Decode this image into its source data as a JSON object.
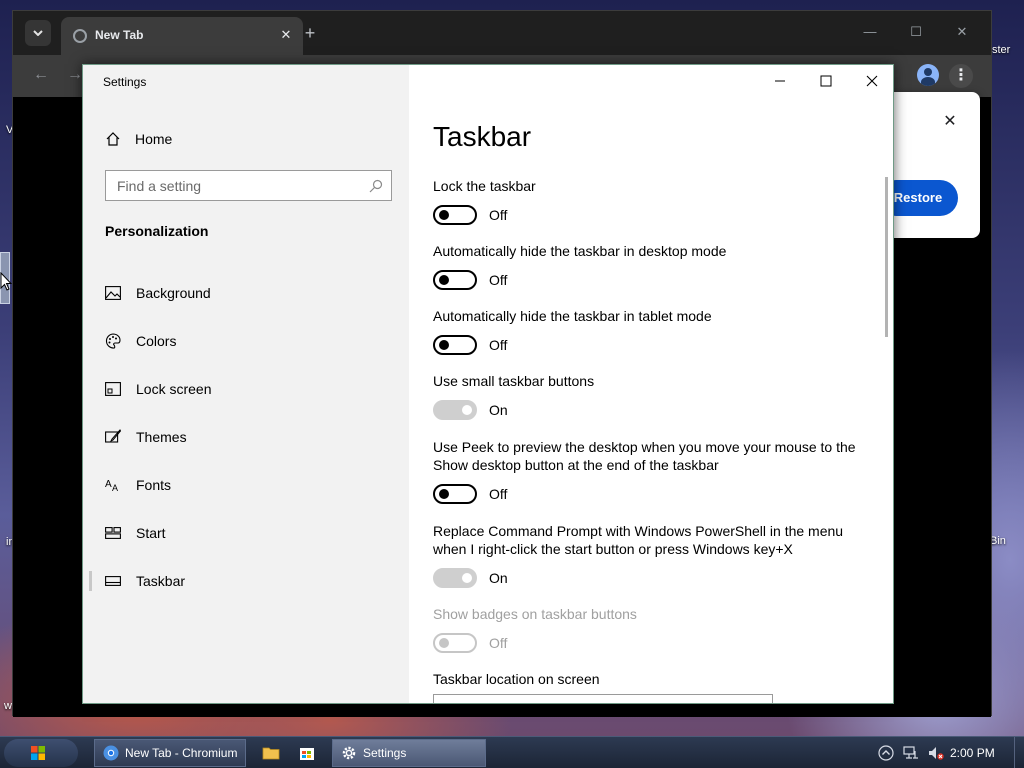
{
  "desktop": {
    "labels": {
      "left_top": "V",
      "left_mid": "in",
      "left_bot": "w",
      "right_top": "ster",
      "right_mid": "Bin"
    }
  },
  "chromium": {
    "tab_title": "New Tab",
    "restore_popup": {
      "button_label": "Restore"
    }
  },
  "settings": {
    "window_title": "Settings",
    "home_label": "Home",
    "search_placeholder": "Find a setting",
    "section_heading": "Personalization",
    "nav_items": [
      {
        "label": "Background",
        "icon": "image-icon"
      },
      {
        "label": "Colors",
        "icon": "palette-icon"
      },
      {
        "label": "Lock screen",
        "icon": "lock-screen-icon"
      },
      {
        "label": "Themes",
        "icon": "themes-icon"
      },
      {
        "label": "Fonts",
        "icon": "fonts-icon"
      },
      {
        "label": "Start",
        "icon": "start-icon"
      },
      {
        "label": "Taskbar",
        "icon": "taskbar-icon",
        "active": true
      }
    ],
    "page_title": "Taskbar",
    "options": [
      {
        "label": "Lock the taskbar",
        "state": "Off"
      },
      {
        "label": "Automatically hide the taskbar in desktop mode",
        "state": "Off"
      },
      {
        "label": "Automatically hide the taskbar in tablet mode",
        "state": "Off"
      },
      {
        "label": "Use small taskbar buttons",
        "state": "On"
      },
      {
        "label": "Use Peek to preview the desktop when you move your mouse to the Show desktop button at the end of the taskbar",
        "state": "Off"
      },
      {
        "label": "Replace Command Prompt with Windows PowerShell in the menu when I right-click the start button or press Windows key+X",
        "state": "On"
      },
      {
        "label": "Show badges on taskbar buttons",
        "state": "Off",
        "disabled": true
      }
    ],
    "location_label": "Taskbar location on screen"
  },
  "taskbar": {
    "tasks": [
      {
        "label": "New Tab - Chromium"
      },
      {
        "label": "Settings"
      }
    ],
    "clock": "2:00 PM"
  },
  "colors": {
    "accent_blue": "#0b57d0",
    "chrome_dark": "#202124",
    "settings_sidebar": "#f2f2f2"
  }
}
